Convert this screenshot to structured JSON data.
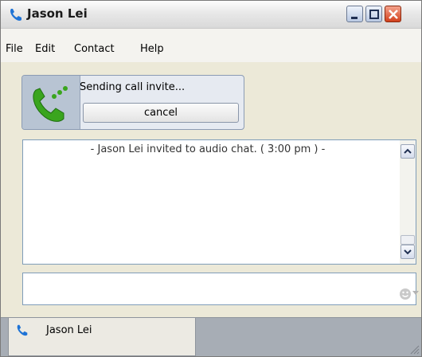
{
  "window": {
    "title": "Jason Lei"
  },
  "menu": {
    "items": [
      "File",
      "Edit",
      "Contact",
      "Help"
    ]
  },
  "call": {
    "status": "Sending call invite...",
    "cancel_label": "cancel"
  },
  "chat": {
    "messages": [
      "- Jason Lei invited to audio chat. ( 3:00 pm ) -"
    ]
  },
  "input": {
    "value": ""
  },
  "tabs": [
    {
      "label": "Jason Lei",
      "icon": "phone-icon"
    }
  ],
  "colors": {
    "phone_green": "#3aa51e",
    "close_red": "#d1401c",
    "tab_strip": "#a7adb5"
  }
}
